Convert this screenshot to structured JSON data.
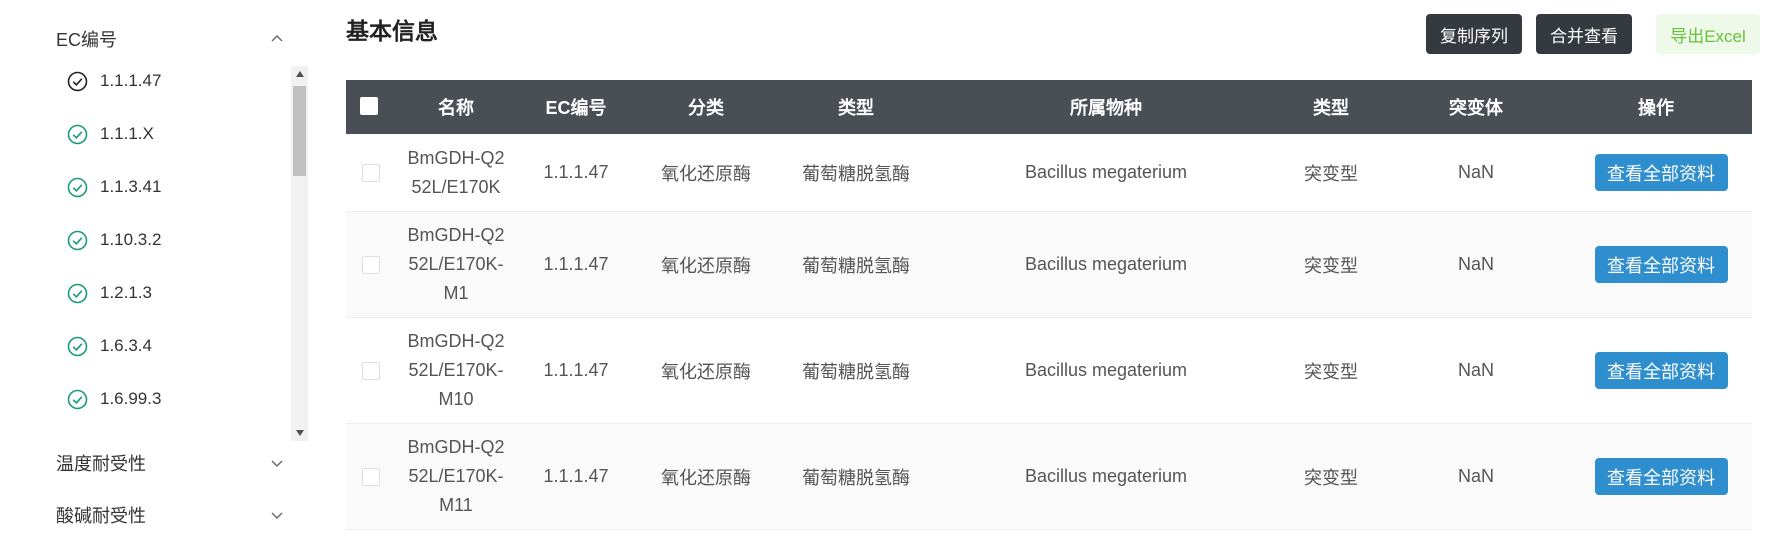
{
  "sidebar": {
    "ec_group": {
      "label": "EC编号"
    },
    "ec_items": [
      "1.1.1.47",
      "1.1.1.X",
      "1.1.3.41",
      "1.10.3.2",
      "1.2.1.3",
      "1.6.3.4",
      "1.6.99.3"
    ],
    "temp_group": {
      "label": "温度耐受性"
    },
    "ph_group": {
      "label": "酸碱耐受性"
    }
  },
  "main": {
    "title": "基本信息",
    "buttons": {
      "copy": "复制序列",
      "merge": "合并查看",
      "export": "导出Excel"
    }
  },
  "table": {
    "headers": [
      "名称",
      "EC编号",
      "分类",
      "类型",
      "所属物种",
      "类型",
      "突变体",
      "操作"
    ],
    "rows": [
      {
        "name_lines": [
          "BmGDH-Q2",
          "52L/E170K"
        ],
        "ec": "1.1.1.47",
        "category": "氧化还原酶",
        "type": "葡萄糖脱氢酶",
        "species": "Bacillus megaterium",
        "type2": "突变型",
        "mutant": "NaN",
        "action": "查看全部资料"
      },
      {
        "name_lines": [
          "BmGDH-Q2",
          "52L/E170K-",
          "M1"
        ],
        "ec": "1.1.1.47",
        "category": "氧化还原酶",
        "type": "葡萄糖脱氢酶",
        "species": "Bacillus megaterium",
        "type2": "突变型",
        "mutant": "NaN",
        "action": "查看全部资料"
      },
      {
        "name_lines": [
          "BmGDH-Q2",
          "52L/E170K-",
          "M10"
        ],
        "ec": "1.1.1.47",
        "category": "氧化还原酶",
        "type": "葡萄糖脱氢酶",
        "species": "Bacillus megaterium",
        "type2": "突变型",
        "mutant": "NaN",
        "action": "查看全部资料"
      },
      {
        "name_lines": [
          "BmGDH-Q2",
          "52L/E170K-",
          "M11"
        ],
        "ec": "1.1.1.47",
        "category": "氧化还原酶",
        "type": "葡萄糖脱氢酶",
        "species": "Bacillus megaterium",
        "type2": "突变型",
        "mutant": "NaN",
        "action": "查看全部资料"
      }
    ]
  },
  "colors": {
    "header_bg": "#4a4f56",
    "primary": "#2f8fce",
    "dark_button": "#353a40",
    "success": "#67c23a",
    "check_green": "#1a9a7a"
  },
  "icons": {
    "ec_item": "check-circle-icon",
    "expand": "chevron-up-icon",
    "collapse": "chevron-down-icon"
  }
}
